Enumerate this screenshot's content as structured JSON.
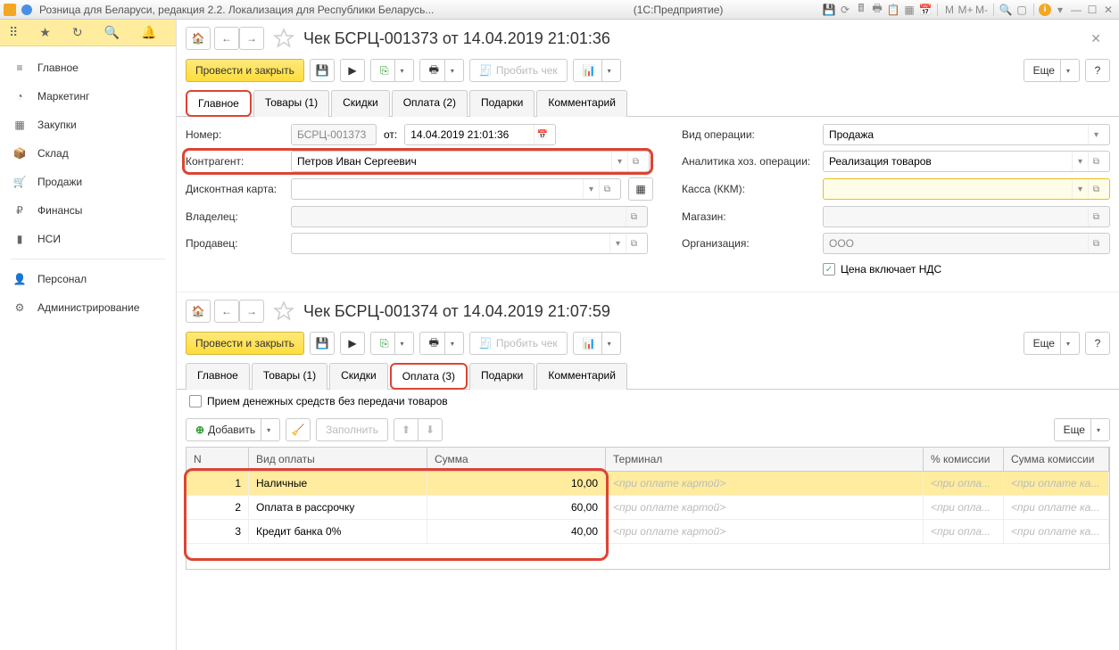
{
  "titlebar": {
    "app_title": "Розница для Беларуси, редакция 2.2. Локализация для Республики Беларусь...",
    "app_mode": "(1С:Предприятие)",
    "m": "M",
    "m_plus": "M+",
    "m_minus": "M-"
  },
  "sidebar": {
    "items": [
      "Главное",
      "Маркетинг",
      "Закупки",
      "Склад",
      "Продажи",
      "Финансы",
      "НСИ",
      "Персонал",
      "Администрирование"
    ]
  },
  "toolbar": {
    "post_close": "Провести и закрыть",
    "punch": "Пробить чек",
    "more": "Еще",
    "help": "?"
  },
  "doc1": {
    "title": "Чек БСРЦ-001373 от 14.04.2019 21:01:36",
    "tabs": [
      "Главное",
      "Товары (1)",
      "Скидки",
      "Оплата (2)",
      "Подарки",
      "Комментарий"
    ],
    "labels": {
      "number": "Номер:",
      "from": "от:",
      "counterparty": "Контрагент:",
      "discount_card": "Дисконтная карта:",
      "owner": "Владелец:",
      "seller": "Продавец:",
      "op_type": "Вид операции:",
      "analytics": "Аналитика хоз. операции:",
      "kkm": "Касса (ККМ):",
      "store": "Магазин:",
      "org": "Организация:",
      "vat": "Цена включает НДС"
    },
    "values": {
      "number": "БСРЦ-001373",
      "date": "14.04.2019 21:01:36",
      "counterparty": "Петров Иван Сергеевич",
      "op_type": "Продажа",
      "analytics": "Реализация товаров",
      "org": "ООО"
    }
  },
  "doc2": {
    "title": "Чек БСРЦ-001374 от 14.04.2019 21:07:59",
    "tabs": [
      "Главное",
      "Товары (1)",
      "Скидки",
      "Оплата (3)",
      "Подарки",
      "Комментарий"
    ],
    "checkbox": "Прием денежных средств без передачи товаров",
    "add": "Добавить",
    "fill": "Заполнить",
    "columns": {
      "n": "N",
      "type": "Вид оплаты",
      "sum": "Сумма",
      "terminal": "Терминал",
      "commission_pct": "% комиссии",
      "commission_sum": "Сумма комиссии"
    },
    "placeholder": {
      "card": "<при оплате картой>",
      "short": "<при опла...",
      "short2": "<при оплате ка..."
    },
    "rows": [
      {
        "n": "1",
        "type": "Наличные",
        "sum": "10,00"
      },
      {
        "n": "2",
        "type": "Оплата в рассрочку",
        "sum": "60,00"
      },
      {
        "n": "3",
        "type": "Кредит банка 0%",
        "sum": "40,00"
      }
    ]
  }
}
